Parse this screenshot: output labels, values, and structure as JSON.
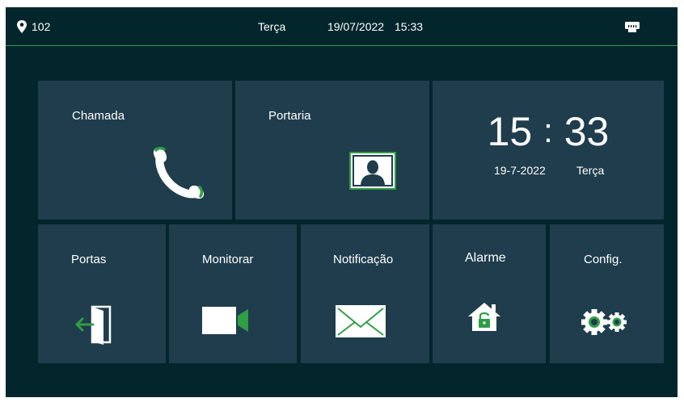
{
  "statusbar": {
    "location_icon": "location-pin-icon",
    "room": "102",
    "weekday": "Terça",
    "date": "19/07/2022",
    "time": "15:33",
    "network_icon": "ethernet-port-icon"
  },
  "tiles": {
    "call": {
      "label": "Chamada",
      "icon": "phone-handset-icon"
    },
    "concierge": {
      "label": "Portaria",
      "icon": "contact-portrait-icon"
    },
    "clock": {
      "hours": "15",
      "separator": ":",
      "minutes": "33",
      "date": "19-7-2022",
      "weekday": "Terça"
    },
    "doors": {
      "label": "Portas",
      "icon": "door-exit-icon"
    },
    "monitor": {
      "label": "Monitorar",
      "icon": "video-camera-icon"
    },
    "notification": {
      "label": "Notificação",
      "icon": "envelope-icon"
    },
    "alarm": {
      "label": "Alarme",
      "icon": "house-lock-icon"
    },
    "settings": {
      "label": "Config.",
      "icon": "gears-icon"
    }
  },
  "colors": {
    "background": "#03262d",
    "tile": "#1f3d4c",
    "accent_green": "#2f9e45",
    "text": "#ffffff"
  }
}
